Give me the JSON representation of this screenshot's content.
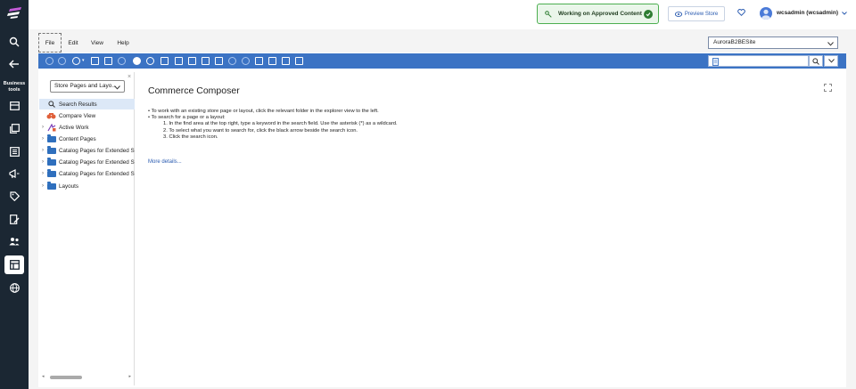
{
  "header": {
    "approved_label": "Working on Approved Content",
    "preview_label": "Preview Store",
    "user_label": "wcsadmin (wcsadmin)"
  },
  "sidebar": {
    "business_tools_label": "Business tools"
  },
  "menubar": {
    "items": [
      "File",
      "Edit",
      "View",
      "Help"
    ],
    "store_selected": "AuroraB2BESite"
  },
  "explorer": {
    "view_selected": "Store Pages and Layo...",
    "items": [
      {
        "label": "Search Results"
      },
      {
        "label": "Compare View"
      },
      {
        "label": "Active Work"
      },
      {
        "label": "Content Pages"
      },
      {
        "label": "Catalog Pages for Extended S"
      },
      {
        "label": "Catalog Pages for Extended S"
      },
      {
        "label": "Catalog Pages for Extended S"
      },
      {
        "label": "Layouts"
      }
    ]
  },
  "content": {
    "title": "Commerce Composer",
    "line1": "• To work with an existing store page or layout, click the relevant folder in the explorer view to the left.",
    "line2": "• To search for a page or a layout:",
    "step1": "1. In the find area at the top right, type a keyword in the search field. Use the asterisk (*) as a wildcard.",
    "step2": "2. To select what you want to search for, click the black arrow beside the search icon.",
    "step3": "3. Click the search icon.",
    "more_link": "More details..."
  },
  "colors": {
    "nav_bg": "#1b2733",
    "toolbar_blue": "#3b73c4",
    "approved_green": "#2e7d32",
    "link_blue": "#2a5bb0",
    "folder_blue": "#2f6fbd"
  }
}
